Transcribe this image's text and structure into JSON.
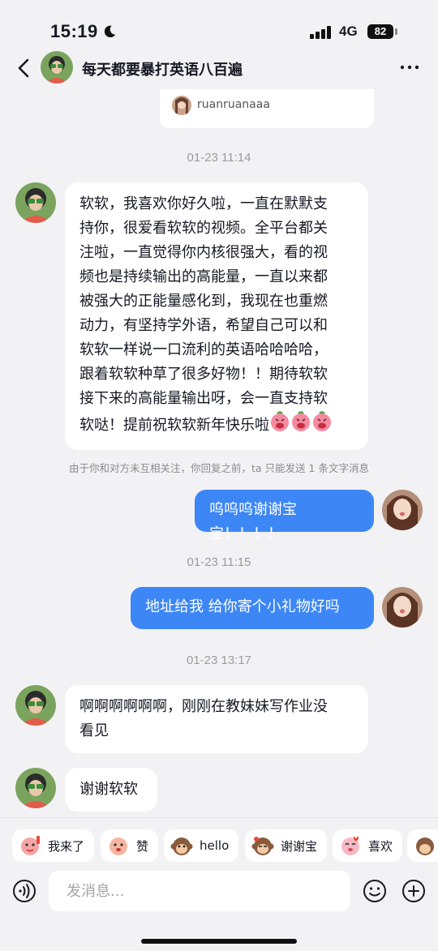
{
  "status_bar": {
    "time": "15:19",
    "network": "4G",
    "battery": "82"
  },
  "header": {
    "title": "每天都要暴打英语八百遍"
  },
  "shared_card": {
    "name": "ruanruanaaa"
  },
  "messages": [
    {
      "type": "timestamp",
      "text": "01-23 11:14"
    },
    {
      "type": "incoming",
      "lines": [
        "软软，我喜欢你好久啦，一直在默默支",
        "持你，很爱看软软的视频。全平台都关",
        "注啦，一直觉得你内核很强大，看的视",
        "频也是持续输出的高能量，一直以来都",
        "被强大的正能量感化到，我现在也重燃",
        "动力，有坚持学外语，希望自己可以和",
        "软软一样说一口流利的英语哈哈哈哈，",
        "跟着软软种草了很多好物！！期待软软",
        "接下来的高能量输出呀，会一直支持软",
        "软哒！提前祝软软新年快乐啦"
      ]
    },
    {
      "type": "notice",
      "text": "由于你和对方未互相关注，你回复之前，ta 只能发送 1 条文字消息"
    },
    {
      "type": "outgoing",
      "text": "呜呜呜谢谢宝宝！！！！"
    },
    {
      "type": "timestamp",
      "text": "01-23 11:15"
    },
    {
      "type": "outgoing",
      "text": "地址给我 给你寄个小礼物好吗"
    },
    {
      "type": "timestamp",
      "text": "01-23 13:17"
    },
    {
      "type": "incoming",
      "lines": [
        "啊啊啊啊啊啊，刚刚在教妹妹写作业没",
        "看见"
      ]
    },
    {
      "type": "incoming",
      "text": "谢谢软软"
    }
  ],
  "quick_replies": [
    {
      "label": "我来了",
      "icon": "sticker-icon"
    },
    {
      "label": "赞",
      "icon": "sticker-icon"
    },
    {
      "label": "hello",
      "icon": "monkey-sticker-icon"
    },
    {
      "label": "谢谢宝",
      "icon": "monkey-sticker-icon"
    },
    {
      "label": "喜欢",
      "icon": "sticker-icon"
    }
  ],
  "input": {
    "placeholder": "发消息..."
  },
  "colors": {
    "accent_blue": "#3d86f6",
    "background": "#f2f2f4",
    "bubble_white": "#ffffff"
  }
}
